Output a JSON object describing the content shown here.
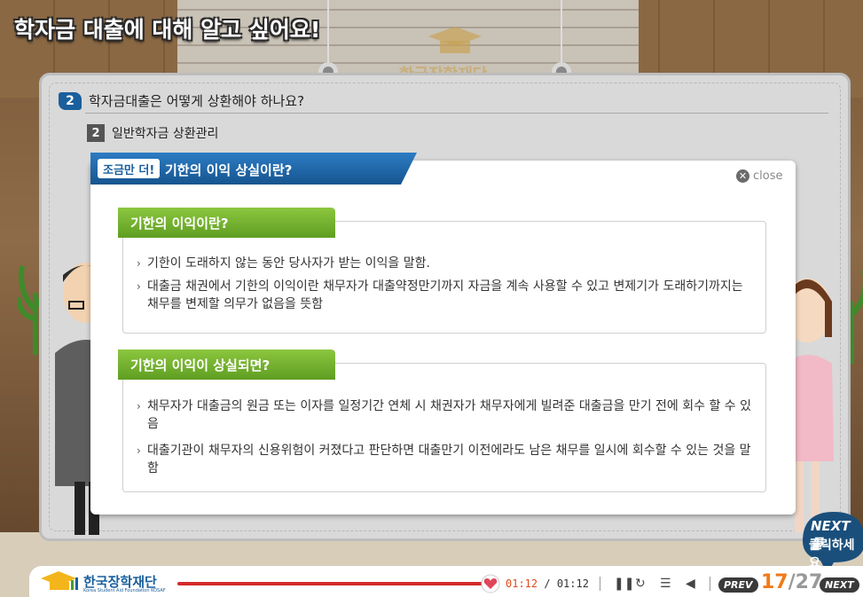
{
  "page_title": "학자금 대출에 대해 알고 싶어요!",
  "wall_logo_text": "한국장학재단",
  "section": {
    "number": "2",
    "title": "학자금대출은 어떻게 상환해야 하나요?"
  },
  "subsection": {
    "number": "2",
    "title": "일반학자금 상환관리"
  },
  "modal": {
    "badge": "조금만 더!",
    "title": "기한의 이익 상실이란?",
    "close_label": "close",
    "boxes": [
      {
        "heading": "기한의 이익이란?",
        "items": [
          "기한이 도래하지 않는 동안 당사자가 받는 이익을 말함.",
          "대출금 채권에서 기한의 이익이란 채무자가 대출약정만기까지 자금을 계속 사용할 수 있고 변제기가 도래하기까지는 채무를 변제할 의무가 없음을 뜻함"
        ]
      },
      {
        "heading": "기한의 이익이 상실되면?",
        "items": [
          "채무자가 대출금의 원금 또는 이자를 일정기간 연체 시 채권자가 채무자에게 빌려준 대출금을 만기 전에 회수 할 수 있음",
          "대출기관이 채무자의 신용위험이 커졌다고 판단하면 대출만기 이전에라도 남은 채무를 일시에 회수할 수 있는 것을 말함"
        ]
      }
    ]
  },
  "next_hint": {
    "line1": "NEXT 를",
    "line2": "클릭하세요"
  },
  "player": {
    "brand_name": "한국장학재단",
    "brand_sub": "Korea Student Aid Foundation KOSAF",
    "progress": 1.0,
    "time_current": "01:12",
    "time_sep": "/",
    "time_total": "01:12",
    "prev_label": "PREV",
    "next_label": "NEXT",
    "page_current": "17",
    "page_sep": "/",
    "page_total": "27"
  },
  "colors": {
    "accent_blue": "#1a5f9c",
    "accent_green": "#6cae2a",
    "progress_red": "#d42a2a",
    "page_orange": "#f07a1a"
  }
}
